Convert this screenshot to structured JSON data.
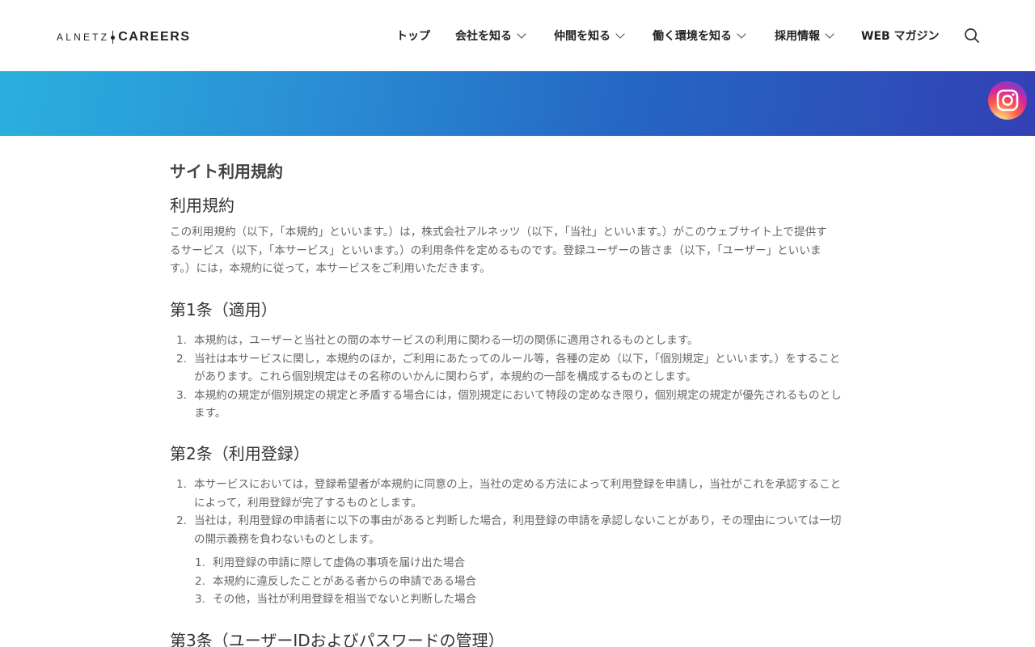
{
  "header": {
    "logo_left": "ALNETZ",
    "logo_right": "CAREERS",
    "nav": [
      {
        "label": "トップ",
        "has_dropdown": false
      },
      {
        "label": "会社を知る",
        "has_dropdown": true
      },
      {
        "label": "仲間を知る",
        "has_dropdown": true
      },
      {
        "label": "働く環境を知る",
        "has_dropdown": true
      },
      {
        "label": "採用情報",
        "has_dropdown": true
      },
      {
        "label": "WEB マガジン",
        "has_dropdown": false
      }
    ],
    "search_icon": "search-icon"
  },
  "banner": {
    "gradient_start": "#2ab0de",
    "gradient_end": "#3241b4",
    "instagram_icon": "instagram-icon"
  },
  "page": {
    "title": "サイト利用規約",
    "section_title": "利用規約",
    "intro_lines": [
      "この利用規約（以下，「本規約」といいます。）は，株式会社アルネッツ（以下，「当社」といいます。）がこのウェブサイト上で提供す",
      "るサービス（以下，「本サービス」といいます。）の利用条件を定めるものです。登録ユーザーの皆さま（以下，「ユーザー」といいま",
      "す。）には，本規約に従って，本サービスをご利用いただきます。"
    ],
    "articles": [
      {
        "title": "第1条（適用）",
        "items": [
          {
            "num": "1.",
            "lines": [
              "本規約は，ユーザーと当社との間の本サービスの利用に関わる一切の関係に適用されるものとします。"
            ]
          },
          {
            "num": "2.",
            "lines": [
              "当社は本サービスに関し，本規約のほか，ご利用にあたってのルール等，各種の定め（以下，「個別規定」といいます。）をすること",
              "があります。これら個別規定はその名称のいかんに関わらず，本規約の一部を構成するものとします。"
            ]
          },
          {
            "num": "3.",
            "lines": [
              "本規約の規定が個別規定の規定と矛盾する場合には，個別規定において特段の定めなき限り，個別規定の規定が優先されるものとし",
              "ます。"
            ]
          }
        ]
      },
      {
        "title": "第2条（利用登録）",
        "items": [
          {
            "num": "1.",
            "lines": [
              "本サービスにおいては，登録希望者が本規約に同意の上，当社の定める方法によって利用登録を申請し，当社がこれを承認すること",
              "によって，利用登録が完了するものとします。"
            ]
          },
          {
            "num": "2.",
            "lines": [
              "当社は，利用登録の申請者に以下の事由があると判断した場合，利用登録の申請を承認しないことがあり，その理由については一切",
              "の開示義務を負わないものとします。"
            ]
          }
        ],
        "subitems": [
          {
            "num": "1.",
            "text": "利用登録の申請に際して虚偽の事項を届け出た場合"
          },
          {
            "num": "2.",
            "text": "本規約に違反したことがある者からの申請である場合"
          },
          {
            "num": "3.",
            "text": "その他，当社が利用登録を相当でないと判断した場合"
          }
        ]
      },
      {
        "title": "第3条（ユーザーIDおよびパスワードの管理）"
      }
    ]
  }
}
